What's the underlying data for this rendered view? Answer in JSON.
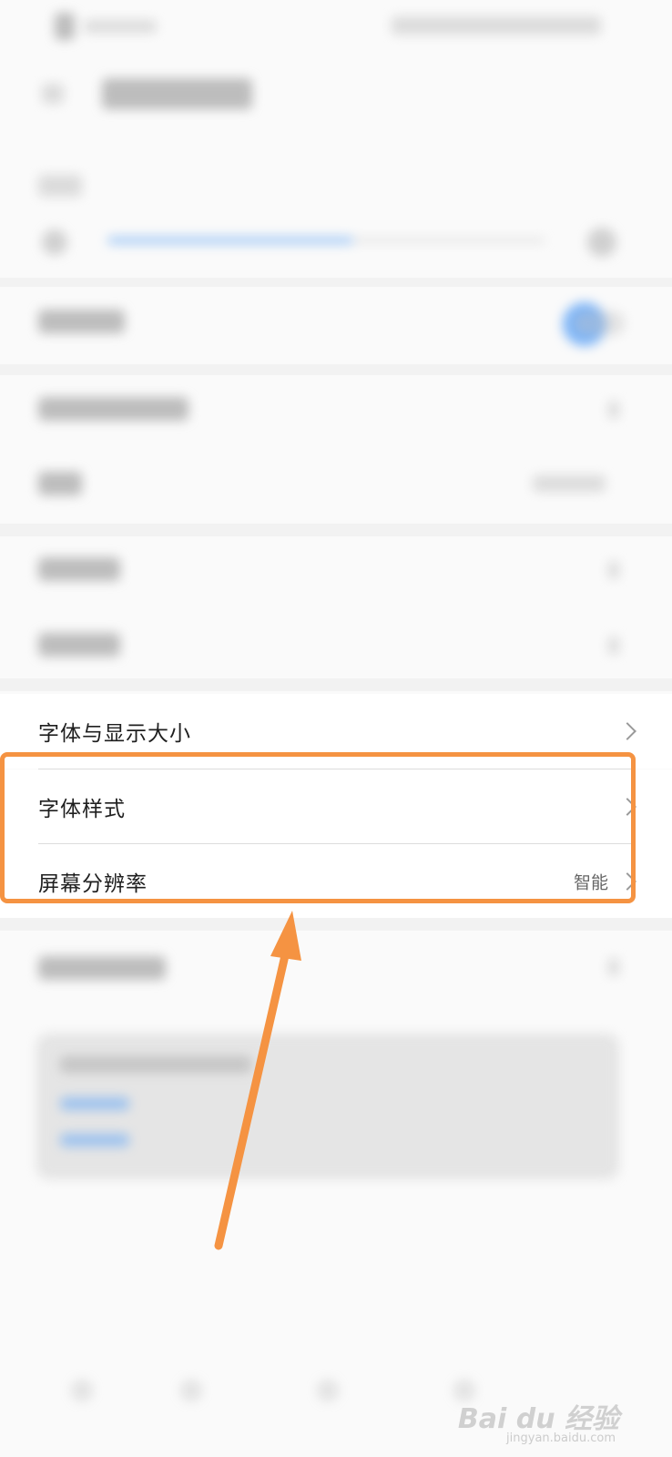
{
  "settings": {
    "items": [
      {
        "label": "字体与显示大小",
        "value": ""
      },
      {
        "label": "字体样式",
        "value": ""
      },
      {
        "label": "屏幕分辨率",
        "value": "智能"
      }
    ]
  },
  "icons": {
    "chevron": "chevron-right-icon",
    "arrow": "arrow-up-icon"
  },
  "colors": {
    "highlight": "#f59342",
    "arrow": "#f59342",
    "toggle_on": "#5ea4f7"
  },
  "watermark": {
    "logo": "Bai  du 经验",
    "url": "jingyan.baidu.com"
  }
}
